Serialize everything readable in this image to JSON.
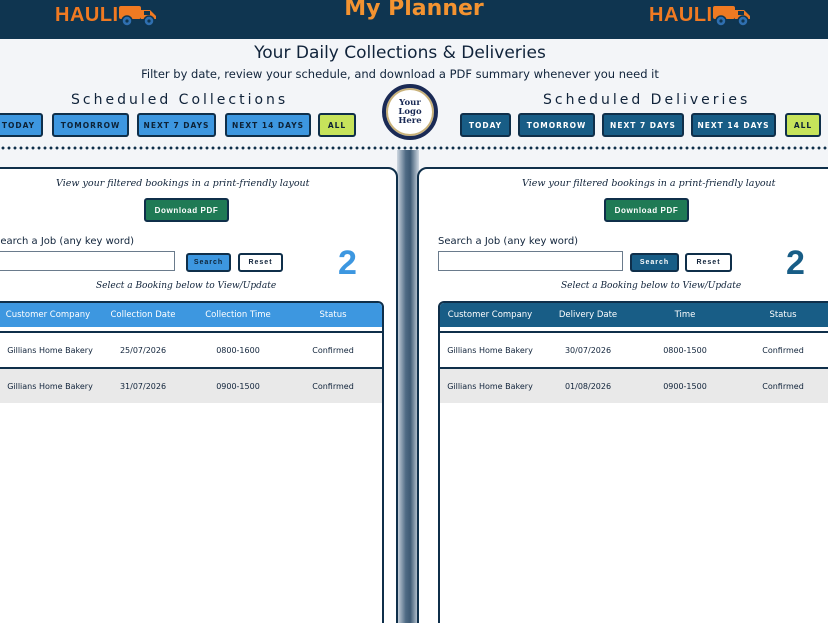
{
  "header": {
    "brand": "HAULI",
    "app_title": "My Planner",
    "colors": {
      "bar": "#0f3550",
      "brand": "#f07a22",
      "title": "#f39331"
    }
  },
  "intro": {
    "headline": "Your Daily Collections & Deliveries",
    "subline": "Filter by date, review your schedule, and download a PDF summary whenever you need it"
  },
  "logo_placeholder": {
    "line1": "Your",
    "line2": "Logo",
    "line3": "Here"
  },
  "collections": {
    "title": "Scheduled Collections",
    "filters": [
      "TODAY",
      "TOMORROW",
      "NEXT 7 DAYS",
      "NEXT 14 DAYS",
      "ALL"
    ],
    "note": "View your filtered bookings in a print-friendly layout",
    "pdf_label": "Download PDF",
    "search_label": "Search a Job (any key word)",
    "search_value": "",
    "search_button": "Search",
    "reset_button": "Reset",
    "count": "2",
    "select_hint": "Select a Booking below to View/Update",
    "columns": [
      "Customer Company",
      "Collection Date",
      "Collection Time",
      "Status"
    ],
    "rows": [
      [
        "Gillians Home Bakery",
        "25/07/2026",
        "0800-1600",
        "Confirmed"
      ],
      [
        "Gillians Home Bakery",
        "31/07/2026",
        "0900-1500",
        "Confirmed"
      ]
    ],
    "accent": "#3d97e0"
  },
  "deliveries": {
    "title": "Scheduled Deliveries",
    "filters": [
      "TODAY",
      "TOMORROW",
      "NEXT 7 DAYS",
      "NEXT 14 DAYS",
      "ALL"
    ],
    "note": "View your filtered bookings in a print-friendly layout",
    "pdf_label": "Download PDF",
    "search_label": "Search a Job (any key word)",
    "search_value": "",
    "search_button": "Search",
    "reset_button": "Reset",
    "count": "2",
    "select_hint": "Select a Booking below to View/Update",
    "columns": [
      "Customer Company",
      "Delivery Date",
      "Time",
      "Status"
    ],
    "rows": [
      [
        "Gillians Home Bakery",
        "30/07/2026",
        "0800-1500",
        "Confirmed"
      ],
      [
        "Gillians Home Bakery",
        "01/08/2026",
        "0900-1500",
        "Confirmed"
      ]
    ],
    "accent": "#185d86"
  }
}
